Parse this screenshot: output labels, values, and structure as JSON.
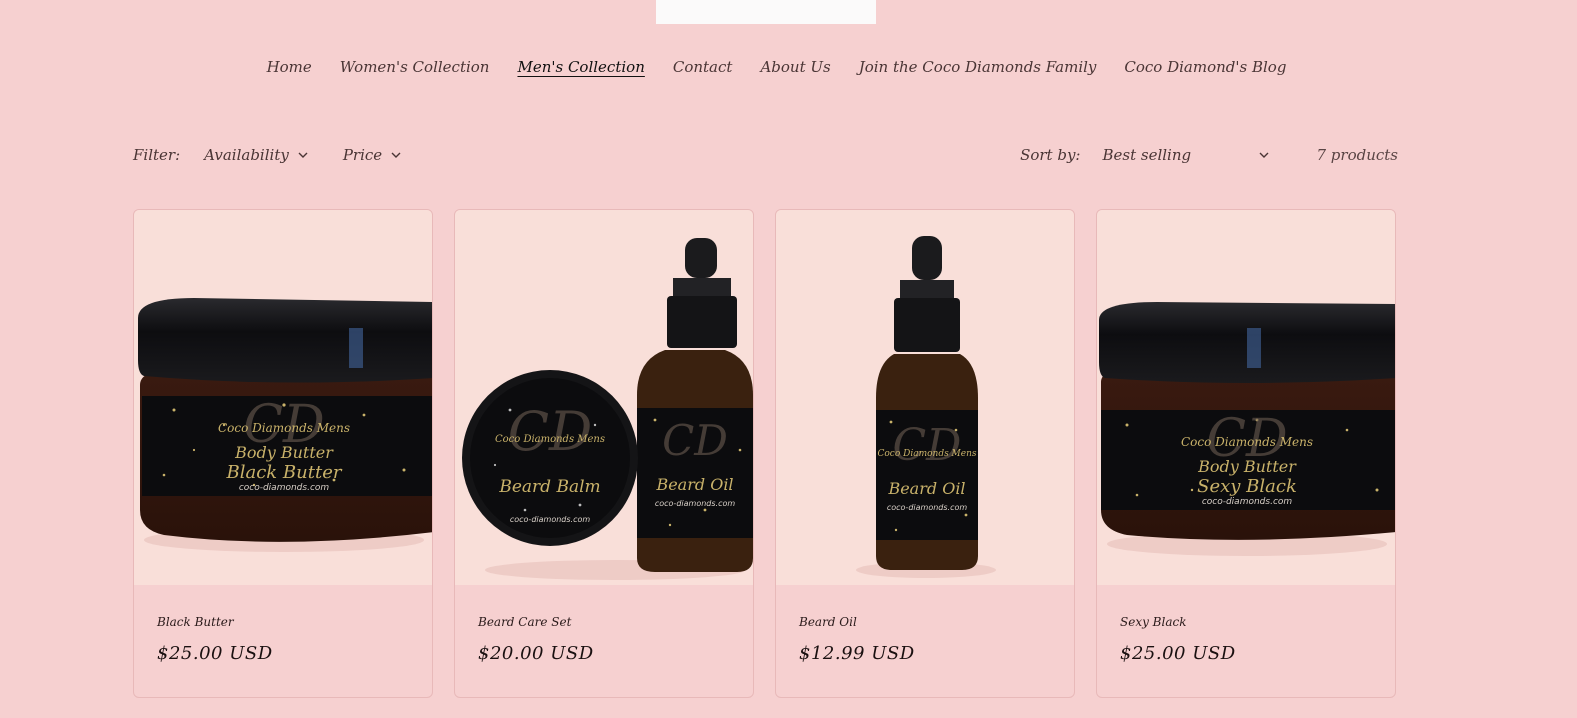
{
  "nav": {
    "items": [
      {
        "label": "Home",
        "active": false
      },
      {
        "label": "Women's Collection",
        "active": false
      },
      {
        "label": "Men's Collection",
        "active": true
      },
      {
        "label": "Contact",
        "active": false
      },
      {
        "label": "About Us",
        "active": false
      },
      {
        "label": "Join the Coco Diamonds Family",
        "active": false
      },
      {
        "label": "Coco Diamond's Blog",
        "active": false
      }
    ]
  },
  "filters": {
    "label": "Filter:",
    "availability": "Availability",
    "price": "Price",
    "sort_label": "Sort by:",
    "sort_value": "Best selling",
    "count": "7 products"
  },
  "products": [
    {
      "title": "Black Butter",
      "price": "$25.00 USD",
      "image": {
        "kind": "jar",
        "label_lines": [
          "Coco Diamonds Mens",
          "Body Butter",
          "Black Butter",
          "coco-diamonds.com"
        ]
      }
    },
    {
      "title": "Beard Care Set",
      "price": "$20.00 USD",
      "image": {
        "kind": "set",
        "label_lines": [
          "Coco Diamonds Mens",
          "Beard Balm",
          "Beard Oil",
          "coco-diamonds.com"
        ]
      }
    },
    {
      "title": "Beard Oil",
      "price": "$12.99 USD",
      "image": {
        "kind": "bottle",
        "label_lines": [
          "Coco Diamonds Mens",
          "Beard Oil",
          "coco-diamonds.com"
        ]
      }
    },
    {
      "title": "Sexy Black",
      "price": "$25.00 USD",
      "image": {
        "kind": "jar",
        "label_lines": [
          "Coco Diamonds Mens",
          "Body Butter",
          "Sexy Black",
          "coco-diamonds.com"
        ]
      }
    }
  ],
  "colors": {
    "background": "#f6d0d0",
    "card_image_bg": "#f9dfd9",
    "label_gold": "#c9b26a"
  }
}
